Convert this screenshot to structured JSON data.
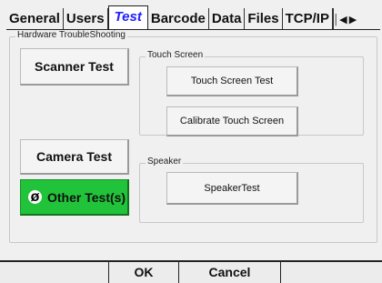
{
  "tabs": [
    {
      "label": "General",
      "active": false
    },
    {
      "label": "Users",
      "active": false
    },
    {
      "label": "Test",
      "active": true
    },
    {
      "label": "Barcode",
      "active": false
    },
    {
      "label": "Data",
      "active": false
    },
    {
      "label": "Files",
      "active": false
    },
    {
      "label": "TCP/IP",
      "active": false
    }
  ],
  "tab_nav": {
    "prev_icon": "first-tab-icon",
    "next_icon": "next-tab-icon"
  },
  "hardware_group": {
    "legend": "Hardware TroubleShooting",
    "scanner_test": "Scanner Test",
    "camera_test": "Camera Test",
    "other_tests": "Other Test(s)",
    "other_tests_icon": "no-entry-icon"
  },
  "touch_group": {
    "legend": "Touch Screen",
    "touch_test": "Touch Screen Test",
    "calibrate": "Calibrate Touch Screen"
  },
  "speaker_group": {
    "legend": "Speaker",
    "speaker_test": "SpeakerTest"
  },
  "footer": {
    "ok": "OK",
    "cancel": "Cancel"
  },
  "colors": {
    "active_tab": "#2020ff",
    "green_button": "#21c33a"
  }
}
